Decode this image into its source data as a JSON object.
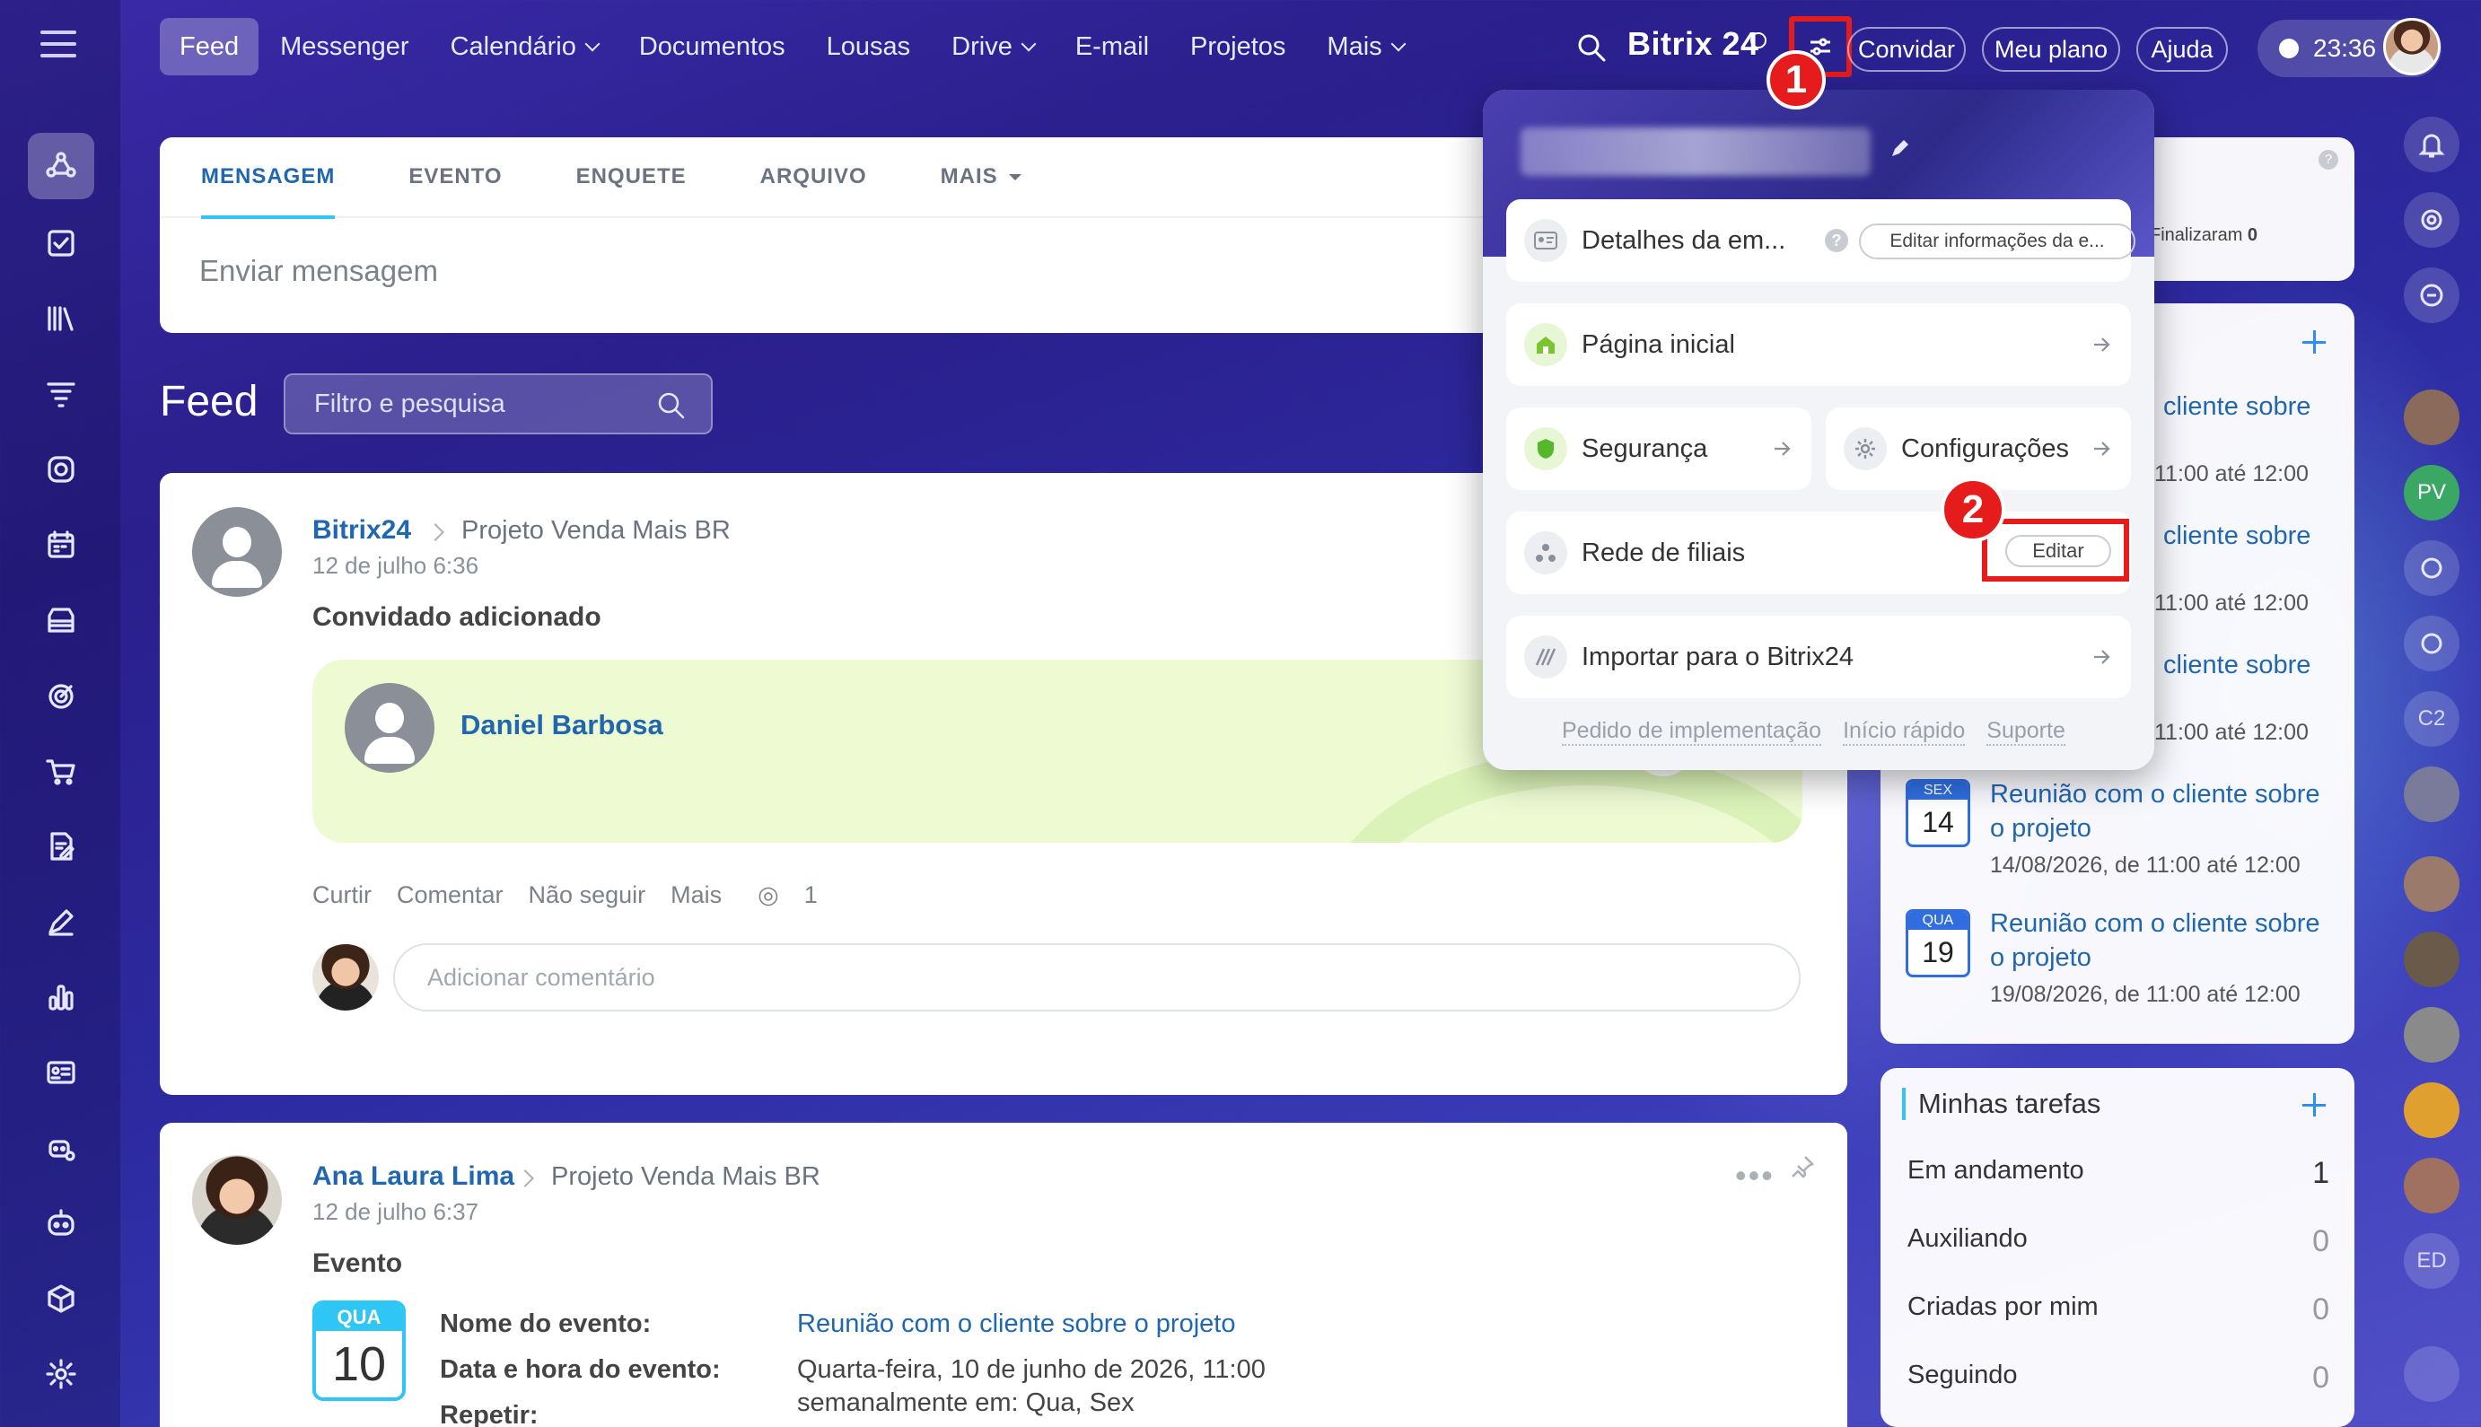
{
  "topnav": {
    "items": [
      {
        "label": "Feed",
        "active": true,
        "dropdown": false
      },
      {
        "label": "Messenger",
        "active": false,
        "dropdown": false
      },
      {
        "label": "Calendário",
        "active": false,
        "dropdown": true
      },
      {
        "label": "Documentos",
        "active": false,
        "dropdown": false
      },
      {
        "label": "Lousas",
        "active": false,
        "dropdown": false
      },
      {
        "label": "Drive",
        "active": false,
        "dropdown": true
      },
      {
        "label": "E-mail",
        "active": false,
        "dropdown": false
      },
      {
        "label": "Projetos",
        "active": false,
        "dropdown": false
      },
      {
        "label": "Mais",
        "active": false,
        "dropdown": true
      }
    ],
    "brand": "Bitrix 24",
    "invite": "Convidar",
    "plan": "Meu plano",
    "help": "Ajuda",
    "time": "23:36"
  },
  "badges": {
    "one": "1",
    "two": "2"
  },
  "composer": {
    "tabs": [
      "MENSAGEM",
      "EVENTO",
      "ENQUETE",
      "ARQUIVO",
      "MAIS"
    ],
    "placeholder": "Enviar mensagem"
  },
  "feed": {
    "title": "Feed",
    "filter_placeholder": "Filtro e pesquisa"
  },
  "post1": {
    "author": "Bitrix24",
    "destination": "Projeto Venda Mais BR",
    "date": "12 de julho 6:36",
    "title": "Convidado adicionado",
    "guest": "Daniel Barbosa",
    "actions": [
      "Curtir",
      "Comentar",
      "Não seguir",
      "Mais"
    ],
    "views": "1",
    "comment_placeholder": "Adicionar comentário"
  },
  "post2": {
    "author": "Ana Laura Lima",
    "destination": "Projeto Venda Mais BR",
    "date": "12 de julho 6:37",
    "title": "Evento",
    "cal_month": "QUA",
    "cal_day": "10",
    "fields": [
      {
        "label": "Nome do evento:",
        "value": "Reunião com o cliente sobre o projeto"
      },
      {
        "label": "Data e hora do evento:",
        "value": "Quarta-feira, 10 de junho de 2026, 11:00"
      },
      {
        "label": "Repetir:",
        "value": "semanalmente em: Qua, Sex"
      }
    ]
  },
  "dropdown": {
    "items": {
      "details": "Detalhes da em...",
      "details_help": "?",
      "details_edit": "Editar informações da e...",
      "home": "Página inicial",
      "security": "Segurança",
      "settings": "Configurações",
      "network": "Rede de filiais",
      "network_edit": "Editar",
      "import": "Importar para o Bitrix24"
    },
    "links": [
      "Pedido de implementação",
      "Início rápido",
      "Suporte"
    ]
  },
  "right": {
    "top_label": "Finalizaram",
    "top_count": "0",
    "events_partial": [
      {
        "title": "cliente sobre",
        "time": "11:00 até 12:00"
      },
      {
        "title": "cliente sobre",
        "time": "11:00 até 12:00"
      },
      {
        "title": "cliente sobre",
        "time": "11:00 até 12:00"
      }
    ],
    "events": [
      {
        "month": "SEX",
        "day": "14",
        "title1": "Reunião com o cliente sobre",
        "title2": "o projeto",
        "time": "14/08/2026, de 11:00 até 12:00"
      },
      {
        "month": "QUA",
        "day": "19",
        "title1": "Reunião com o cliente sobre",
        "title2": "o projeto",
        "time": "19/08/2026, de 11:00 até 12:00"
      }
    ],
    "tasks_title": "Minhas tarefas",
    "tasks": [
      {
        "label": "Em andamento",
        "count": "1"
      },
      {
        "label": "Auxiliando",
        "count": "0"
      },
      {
        "label": "Criadas por mim",
        "count": "0"
      },
      {
        "label": "Seguindo",
        "count": "0"
      }
    ]
  },
  "rail": {
    "initials1": "PV",
    "initials2": "C2",
    "initials3": "ED"
  }
}
